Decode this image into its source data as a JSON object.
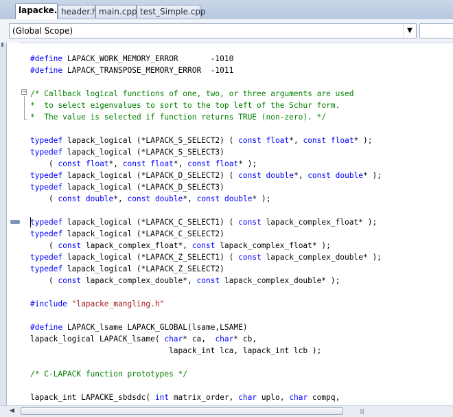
{
  "tabs": [
    {
      "label": "lapacke.h",
      "active": true
    },
    {
      "label": "header.h",
      "active": false
    },
    {
      "label": "main.cpp",
      "active": false
    },
    {
      "label": "test_Simple.cpp",
      "active": false
    }
  ],
  "scope": {
    "value": "(Global Scope)",
    "arrow": "▼"
  },
  "fold_marker": "−",
  "scrollbar": {
    "left_arrow": "◀",
    "grip": "|||"
  },
  "code": [
    [
      {
        "t": "#define",
        "c": "kw"
      },
      {
        "t": " LAPACK_WORK_MEMORY_ERROR       -1010"
      }
    ],
    [
      {
        "t": "#define",
        "c": "kw"
      },
      {
        "t": " LAPACK_TRANSPOSE_MEMORY_ERROR  -1011"
      }
    ],
    [],
    [
      {
        "t": "/* Callback logical functions of one, two, or three arguments are used",
        "c": "cm"
      }
    ],
    [
      {
        "t": "*  to select eigenvalues to sort to the top left of the Schur form.",
        "c": "cm"
      }
    ],
    [
      {
        "t": "*  The value is selected if function returns TRUE (non-zero). */",
        "c": "cm"
      }
    ],
    [],
    [
      {
        "t": "typedef",
        "c": "kw"
      },
      {
        "t": " lapack_logical (*LAPACK_S_SELECT2) ( "
      },
      {
        "t": "const",
        "c": "kw"
      },
      {
        "t": " "
      },
      {
        "t": "float",
        "c": "kw"
      },
      {
        "t": "*, "
      },
      {
        "t": "const",
        "c": "kw"
      },
      {
        "t": " "
      },
      {
        "t": "float",
        "c": "kw"
      },
      {
        "t": "* );"
      }
    ],
    [
      {
        "t": "typedef",
        "c": "kw"
      },
      {
        "t": " lapack_logical (*LAPACK_S_SELECT3)"
      }
    ],
    [
      {
        "t": "    ( "
      },
      {
        "t": "const",
        "c": "kw"
      },
      {
        "t": " "
      },
      {
        "t": "float",
        "c": "kw"
      },
      {
        "t": "*, "
      },
      {
        "t": "const",
        "c": "kw"
      },
      {
        "t": " "
      },
      {
        "t": "float",
        "c": "kw"
      },
      {
        "t": "*, "
      },
      {
        "t": "const",
        "c": "kw"
      },
      {
        "t": " "
      },
      {
        "t": "float",
        "c": "kw"
      },
      {
        "t": "* );"
      }
    ],
    [
      {
        "t": "typedef",
        "c": "kw"
      },
      {
        "t": " lapack_logical (*LAPACK_D_SELECT2) ( "
      },
      {
        "t": "const",
        "c": "kw"
      },
      {
        "t": " "
      },
      {
        "t": "double",
        "c": "kw"
      },
      {
        "t": "*, "
      },
      {
        "t": "const",
        "c": "kw"
      },
      {
        "t": " "
      },
      {
        "t": "double",
        "c": "kw"
      },
      {
        "t": "* );"
      }
    ],
    [
      {
        "t": "typedef",
        "c": "kw"
      },
      {
        "t": " lapack_logical (*LAPACK_D_SELECT3)"
      }
    ],
    [
      {
        "t": "    ( "
      },
      {
        "t": "const",
        "c": "kw"
      },
      {
        "t": " "
      },
      {
        "t": "double",
        "c": "kw"
      },
      {
        "t": "*, "
      },
      {
        "t": "const",
        "c": "kw"
      },
      {
        "t": " "
      },
      {
        "t": "double",
        "c": "kw"
      },
      {
        "t": "*, "
      },
      {
        "t": "const",
        "c": "kw"
      },
      {
        "t": " "
      },
      {
        "t": "double",
        "c": "kw"
      },
      {
        "t": "* );"
      }
    ],
    [],
    [
      {
        "t": "typedef",
        "c": "kw"
      },
      {
        "t": " lapack_logical (*LAPACK_C_SELECT1) ( "
      },
      {
        "t": "const",
        "c": "kw"
      },
      {
        "t": " lapack_complex_float* );"
      }
    ],
    [
      {
        "t": "typedef",
        "c": "kw"
      },
      {
        "t": " lapack_logical (*LAPACK_C_SELECT2)"
      }
    ],
    [
      {
        "t": "    ( "
      },
      {
        "t": "const",
        "c": "kw"
      },
      {
        "t": " lapack_complex_float*, "
      },
      {
        "t": "const",
        "c": "kw"
      },
      {
        "t": " lapack_complex_float* );"
      }
    ],
    [
      {
        "t": "typedef",
        "c": "kw"
      },
      {
        "t": " lapack_logical (*LAPACK_Z_SELECT1) ( "
      },
      {
        "t": "const",
        "c": "kw"
      },
      {
        "t": " lapack_complex_double* );"
      }
    ],
    [
      {
        "t": "typedef",
        "c": "kw"
      },
      {
        "t": " lapack_logical (*LAPACK_Z_SELECT2)"
      }
    ],
    [
      {
        "t": "    ( "
      },
      {
        "t": "const",
        "c": "kw"
      },
      {
        "t": " lapack_complex_double*, "
      },
      {
        "t": "const",
        "c": "kw"
      },
      {
        "t": " lapack_complex_double* );"
      }
    ],
    [],
    [
      {
        "t": "#include",
        "c": "kw"
      },
      {
        "t": " "
      },
      {
        "t": "\"lapacke_mangling.h\"",
        "c": "str"
      }
    ],
    [],
    [
      {
        "t": "#define",
        "c": "kw"
      },
      {
        "t": " LAPACK_lsame LAPACK_GLOBAL(lsame,LSAME)"
      }
    ],
    [
      {
        "t": "lapack_logical LAPACK_lsame( "
      },
      {
        "t": "char",
        "c": "kw"
      },
      {
        "t": "* ca,  "
      },
      {
        "t": "char",
        "c": "kw"
      },
      {
        "t": "* cb,"
      }
    ],
    [
      {
        "t": "                              lapack_int lca, lapack_int lcb );"
      }
    ],
    [],
    [
      {
        "t": "/* C-LAPACK function prototypes */",
        "c": "cm"
      }
    ],
    [],
    [
      {
        "t": "lapack_int LAPACKE_sbdsdc( "
      },
      {
        "t": "int",
        "c": "kw"
      },
      {
        "t": " matrix_order, "
      },
      {
        "t": "char",
        "c": "kw"
      },
      {
        "t": " uplo, "
      },
      {
        "t": "char",
        "c": "kw"
      },
      {
        "t": " compq,"
      }
    ]
  ]
}
